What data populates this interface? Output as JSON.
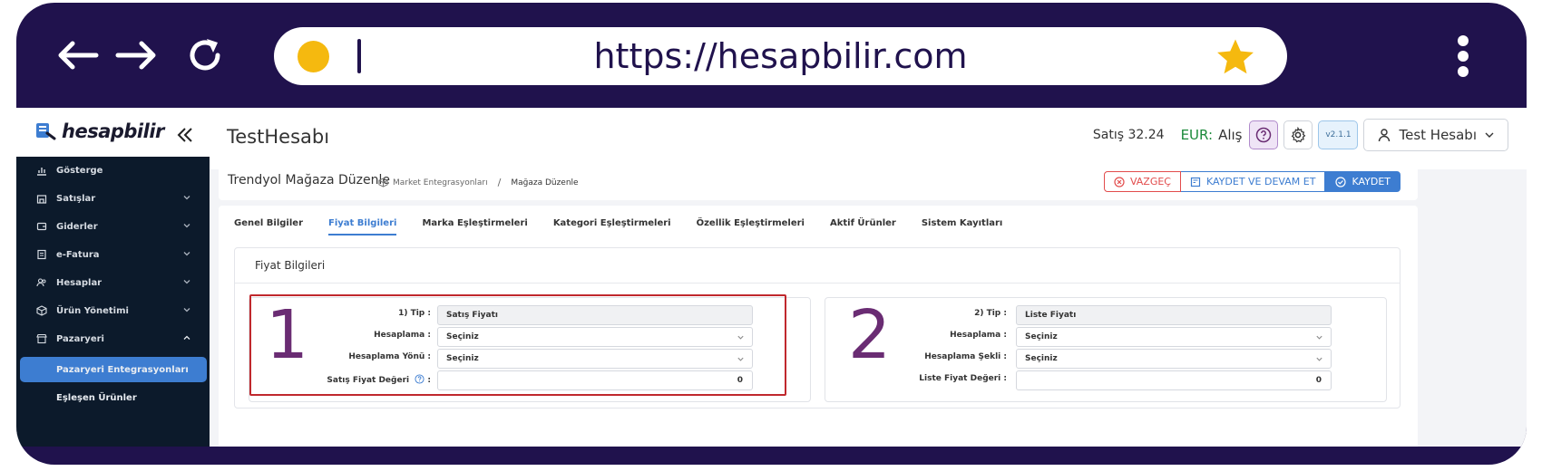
{
  "browser": {
    "url": "https://hesapbilir.com",
    "colors": {
      "frame": "#20124d",
      "dot": "#f5b90f",
      "star": "#f5b90f"
    }
  },
  "header": {
    "logo_text": "hesapbilir",
    "app_title": "TestHesabı",
    "rate_text": "Satış 32.24",
    "currency_label": "EUR:",
    "alis_label": "Alış",
    "version": "v2.1.1",
    "user_name": "Test Hesabı"
  },
  "sidebar": {
    "items": [
      {
        "label": "Gösterge",
        "icon": "chart-icon"
      },
      {
        "label": "Satışlar",
        "icon": "store-icon"
      },
      {
        "label": "Giderler",
        "icon": "wallet-icon"
      },
      {
        "label": "e-Fatura",
        "icon": "invoice-icon"
      },
      {
        "label": "Hesaplar",
        "icon": "users-icon"
      },
      {
        "label": "Ürün Yönetimi",
        "icon": "box-icon"
      },
      {
        "label": "Pazaryeri",
        "icon": "marketplace-icon"
      }
    ],
    "sub_items": [
      {
        "label": "Pazaryeri Entegrasyonları",
        "active": true
      },
      {
        "label": "Eşleşen Ürünler",
        "active": false
      }
    ]
  },
  "page": {
    "title": "Trendyol Mağaza Düzenle",
    "breadcrumb": [
      "Market Entegrasyonları",
      "/",
      "Mağaza Düzenle"
    ],
    "buttons": {
      "cancel": "VAZGEÇ",
      "save_continue": "KAYDET VE DEVAM ET",
      "save": "KAYDET"
    }
  },
  "tabs": [
    {
      "label": "Genel Bilgiler",
      "active": false
    },
    {
      "label": "Fiyat Bilgileri",
      "active": true
    },
    {
      "label": "Marka Eşleştirmeleri",
      "active": false
    },
    {
      "label": "Kategori Eşleştirmeleri",
      "active": false
    },
    {
      "label": "Özellik Eşleştirmeleri",
      "active": false
    },
    {
      "label": "Aktif Ürünler",
      "active": false
    },
    {
      "label": "Sistem Kayıtları",
      "active": false
    }
  ],
  "section": {
    "title": "Fiyat Bilgileri",
    "panel1": {
      "number": "1",
      "rows": [
        {
          "label": "1) Tip :",
          "value": "Satış Fiyatı"
        },
        {
          "label": "Hesaplama :",
          "value": "Seçiniz"
        },
        {
          "label": "Hesaplama Yönü :",
          "value": "Seçiniz"
        },
        {
          "label": "Satış Fiyat Değeri",
          "label_suffix": ":",
          "value": "0"
        }
      ]
    },
    "panel2": {
      "number": "2",
      "rows": [
        {
          "label": "2) Tip :",
          "value": "Liste Fiyatı"
        },
        {
          "label": "Hesaplama :",
          "value": "Seçiniz"
        },
        {
          "label": "Hesaplama Şekli :",
          "value": "Seçiniz"
        },
        {
          "label": "Liste Fiyat Değeri :",
          "value": "0"
        }
      ]
    }
  },
  "colors": {
    "accent": "#3d7dd1",
    "danger": "#e24c4c",
    "sidebar": "#0c1a2b",
    "highlight": "#c0282d",
    "number": "#6a2c73"
  }
}
